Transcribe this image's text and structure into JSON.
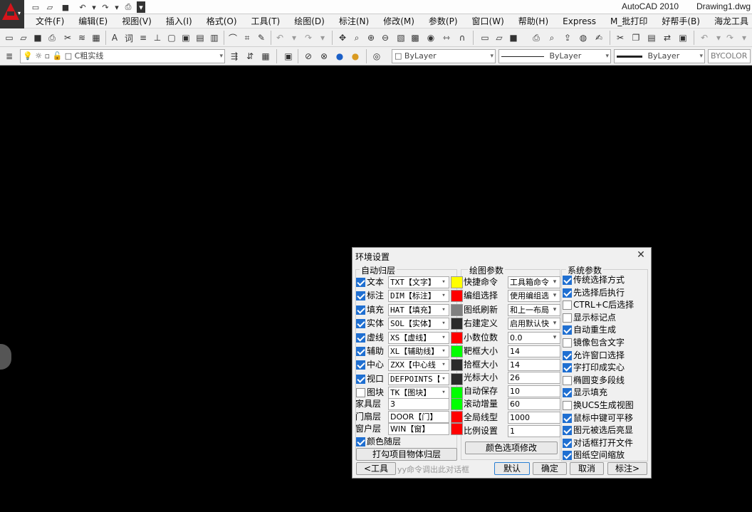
{
  "title": {
    "app": "AutoCAD 2010",
    "document": "Drawing1.dwg"
  },
  "menu": [
    "文件(F)",
    "编辑(E)",
    "视图(V)",
    "插入(I)",
    "格式(O)",
    "工具(T)",
    "绘图(D)",
    "标注(N)",
    "修改(M)",
    "参数(P)",
    "窗口(W)",
    "帮助(H)",
    "Express",
    "M_批打印",
    "好帮手(B)",
    "海龙工具"
  ],
  "toolbar": {
    "layer_combo": "C粗实线",
    "color_combo": "ByLayer",
    "linetype_combo": "ByLayer",
    "lineweight_combo": "ByLayer",
    "plotstyle_combo": "BYCOLOR"
  },
  "dialog": {
    "title": "环境设置",
    "close": "✕",
    "auto_layer": {
      "label": "自动归层",
      "rows": [
        {
          "name": "文本",
          "checked": true,
          "value": "TXT【文字】",
          "color": "#ffff00"
        },
        {
          "name": "标注",
          "checked": true,
          "value": "DIM【标注】",
          "color": "#ff0000"
        },
        {
          "name": "填充",
          "checked": true,
          "value": "HAT【填充】",
          "color": "#808080"
        },
        {
          "name": "实体",
          "checked": true,
          "value": "SOL【实体】",
          "color": "#2b2b2b"
        },
        {
          "name": "虚线",
          "checked": true,
          "value": "XS【虚线】",
          "color": "#ff0000"
        },
        {
          "name": "辅助",
          "checked": true,
          "value": "XL【辅助线】",
          "color": "#00ff00"
        },
        {
          "name": "中心",
          "checked": true,
          "value": "ZXX【中心线",
          "color": "#2b2b2b"
        },
        {
          "name": "视口",
          "checked": true,
          "value": "DEFPOINTS【",
          "color": "#2b2b2b"
        },
        {
          "name": "图块",
          "checked": false,
          "value": "TK【图块】",
          "color": "#00ff00"
        }
      ],
      "text_rows": [
        {
          "name": "家具层",
          "value": "3",
          "color": "#00ff00"
        },
        {
          "name": "门扇层",
          "value": "DOOR【门】",
          "color": "#ff0000"
        },
        {
          "name": "窗户层",
          "value": "WIN【窗】",
          "color": "#ff0000"
        }
      ],
      "follow_color": "颜色随层",
      "follow_color_checked": true,
      "apply_button": "打勾项目物体归层"
    },
    "draw_params": {
      "label": "绘图参数",
      "rows": [
        {
          "name": "快捷命令",
          "value": "工具箱命令",
          "type": "select"
        },
        {
          "name": "编组选择",
          "value": "使用编组选",
          "type": "select"
        },
        {
          "name": "图纸刷新",
          "value": "和上一布局",
          "type": "select"
        },
        {
          "name": "右建定义",
          "value": "启用默认快",
          "type": "select"
        },
        {
          "name": "小数位数",
          "value": "0.0",
          "type": "select"
        },
        {
          "name": "靶框大小",
          "value": "14",
          "type": "input"
        },
        {
          "name": "拾框大小",
          "value": "14",
          "type": "input"
        },
        {
          "name": "光标大小",
          "value": "26",
          "type": "input"
        },
        {
          "name": "自动保存",
          "value": "10",
          "type": "input"
        },
        {
          "name": "滚动增量",
          "value": "60",
          "type": "input"
        },
        {
          "name": "全局线型",
          "value": "1000",
          "type": "input"
        },
        {
          "name": "比例设置",
          "value": "1",
          "type": "input"
        }
      ],
      "color_button": "颜色选项修改"
    },
    "system_params": {
      "label": "系统参数",
      "rows": [
        {
          "name": "传统选择方式",
          "checked": true
        },
        {
          "name": "先选择后执行",
          "checked": true
        },
        {
          "name": "CTRL+C后选择",
          "checked": false
        },
        {
          "name": "显示标记点",
          "checked": false
        },
        {
          "name": "自动重生成",
          "checked": true
        },
        {
          "name": "镜像包含文字",
          "checked": false
        },
        {
          "name": "允许窗口选择",
          "checked": true
        },
        {
          "name": "字打印成实心",
          "checked": true
        },
        {
          "name": "椭圆变多段线",
          "checked": false
        },
        {
          "name": "显示填充",
          "checked": true
        },
        {
          "name": "换UCS生成视图",
          "checked": false
        },
        {
          "name": "鼠标中键可平移",
          "checked": true
        },
        {
          "name": "图元被选后亮显",
          "checked": true
        },
        {
          "name": "对话框打开文件",
          "checked": true
        },
        {
          "name": "图纸空间缩放",
          "checked": true
        }
      ]
    },
    "bottom": {
      "tools_button": "<工具",
      "hint": "yy命令调出此对话框",
      "default_button": "默认",
      "ok_button": "确定",
      "cancel_button": "取消",
      "note_button": "标注>"
    }
  }
}
